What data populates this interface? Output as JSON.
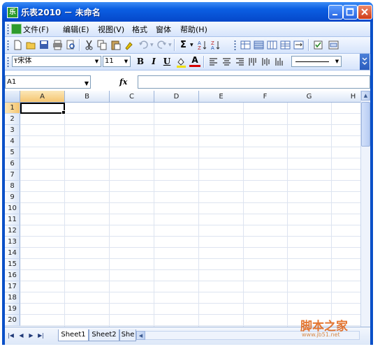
{
  "window": {
    "title": "乐表2010 － 未命名",
    "icon": "app-logo-icon",
    "controls": [
      "minimize-icon",
      "maximize-icon",
      "close-icon"
    ]
  },
  "menubar": {
    "items": [
      {
        "label": "文件(F)"
      },
      {
        "label": "编辑(E)"
      },
      {
        "label": "视图(V)"
      },
      {
        "label": "格式"
      },
      {
        "label": "窗体"
      },
      {
        "label": "帮助(H)"
      }
    ]
  },
  "toolbar_standard": {
    "icons": [
      "new-icon",
      "open-icon",
      "save-icon",
      "print-icon",
      "print-preview-icon",
      "cut-icon",
      "copy-icon",
      "paste-icon",
      "format-painter-icon",
      "undo-icon",
      "redo-icon",
      "sum-icon",
      "sort-ascending-icon",
      "sort-descending-icon",
      "freeze-icon",
      "border-icon",
      "column-icon",
      "row-icon",
      "merge-icon",
      "checkbox-icon",
      "form-icon"
    ],
    "sum_label": "Σ"
  },
  "toolbar_format": {
    "font_name": "宋体",
    "font_size": "11",
    "bold_label": "B",
    "italic_label": "I",
    "underline_label": "U",
    "fill_label": "A",
    "font_color_label": "A"
  },
  "formula_bar": {
    "name_box": "A1",
    "fx_label": "fx",
    "formula_value": ""
  },
  "sheet": {
    "columns": [
      "A",
      "B",
      "C",
      "D",
      "E",
      "F",
      "G",
      "H"
    ],
    "rows": [
      "1",
      "2",
      "3",
      "4",
      "5",
      "6",
      "7",
      "8",
      "9",
      "10",
      "11",
      "12",
      "13",
      "14",
      "15",
      "16",
      "17",
      "18",
      "19",
      "20"
    ],
    "active_cell": "A1"
  },
  "tabs": [
    {
      "label": "Sheet1",
      "active": true
    },
    {
      "label": "Sheet2",
      "active": false
    },
    {
      "label": "She",
      "active": false
    }
  ],
  "watermark": {
    "text": "脚本之家",
    "url": "www.jb51.net"
  },
  "colors": {
    "titlebar": "#0b5fe3",
    "accent_selected": "#f5c570",
    "toolbar": "#d6e4fb"
  }
}
